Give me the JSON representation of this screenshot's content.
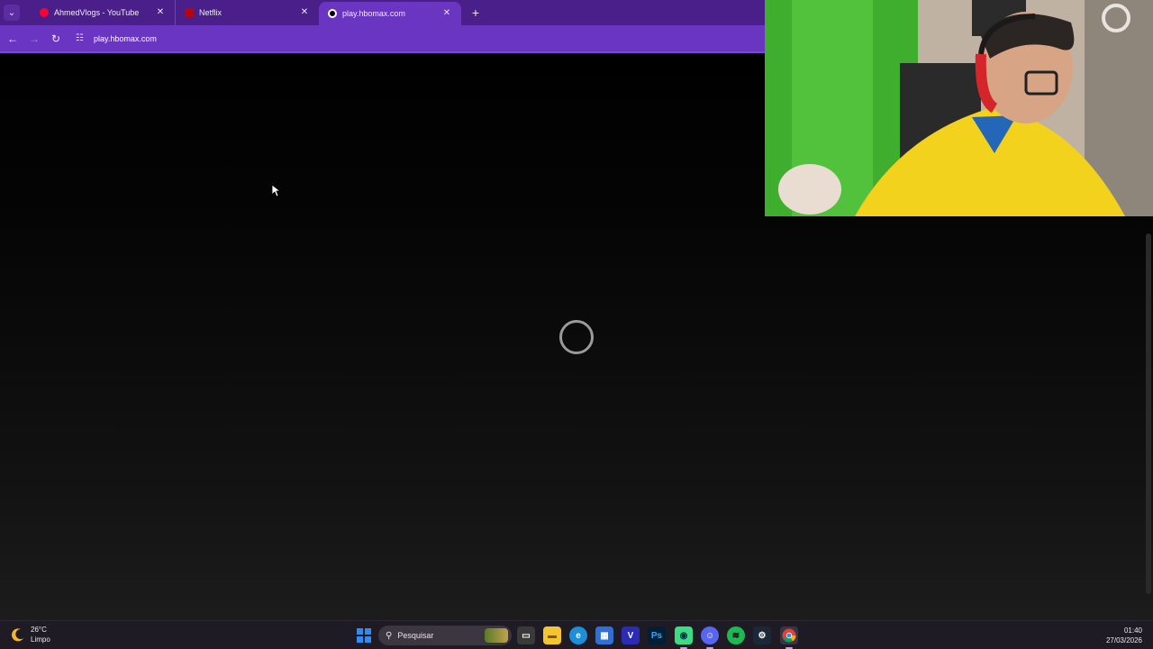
{
  "browser": {
    "tabs": [
      {
        "title": "AhmedVlogs - YouTube",
        "favicon": "youtube-icon",
        "color": "#ff0033"
      },
      {
        "title": "Netflix",
        "favicon": "netflix-icon",
        "color": "#b20710"
      },
      {
        "title": "play.hbomax.com",
        "favicon": "hbomax-icon",
        "color": "#ffffff",
        "active": true
      }
    ],
    "new_tab_label": "+",
    "address": "play.hbomax.com",
    "theme_color": "#6a35c0"
  },
  "page": {
    "state": "loading",
    "spinner": "loading-spinner-icon"
  },
  "taskbar": {
    "weather": {
      "temperature": "26°C",
      "condition": "Limpo"
    },
    "search_placeholder": "Pesquisar",
    "apps": [
      "file-explorer-icon",
      "edge-icon",
      "store-icon",
      "vegas-icon",
      "photoshop-icon",
      "android-studio-icon",
      "discord-icon",
      "spotify-icon",
      "steam-icon",
      "chrome-icon"
    ],
    "discord_badge": "9+",
    "time": "01:40",
    "date": "27/03/2026"
  }
}
